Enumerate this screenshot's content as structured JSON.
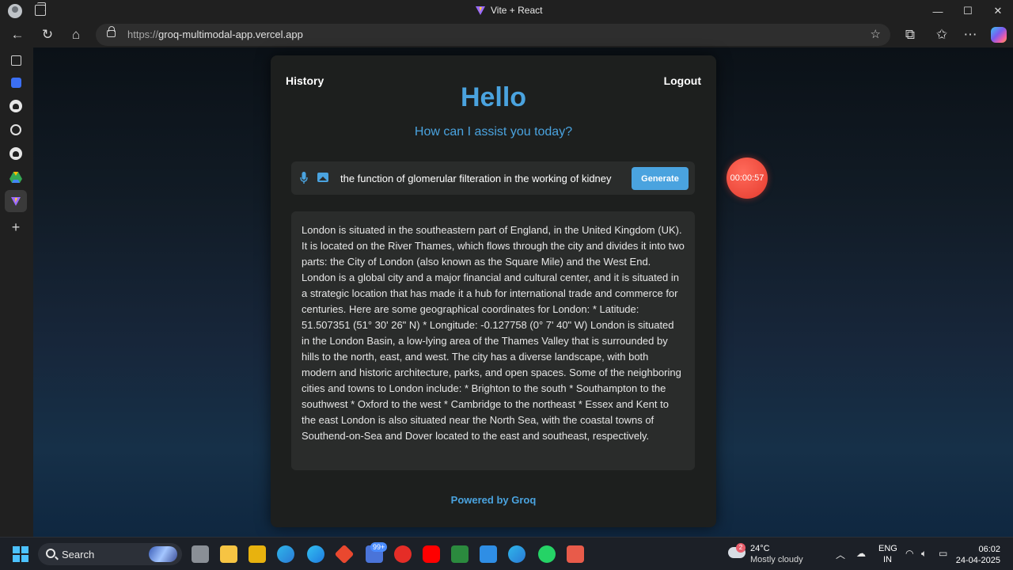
{
  "browser": {
    "tab_title": "Vite + React",
    "url_protocol": "https://",
    "url_host": "groq-multimodal-app.vercel.app",
    "controls": {
      "minimize": "—",
      "maximize": "☐",
      "close": "✕"
    }
  },
  "app": {
    "history_label": "History",
    "logout_label": "Logout",
    "heading": "Hello",
    "subheading": "How can I assist you today?",
    "prompt_value": "the function of glomerular filteration in the working of kidney",
    "generate_label": "Generate",
    "response_text": "London is situated in the southeastern part of England, in the United Kingdom (UK). It is located on the River Thames, which flows through the city and divides it into two parts: the City of London (also known as the Square Mile) and the West End. London is a global city and a major financial and cultural center, and it is situated in a strategic location that has made it a hub for international trade and commerce for centuries. Here are some geographical coordinates for London: * Latitude: 51.507351 (51° 30' 26\" N) * Longitude: -0.127758 (0° 7' 40\" W) London is situated in the London Basin, a low-lying area of the Thames Valley that is surrounded by hills to the north, east, and west. The city has a diverse landscape, with both modern and historic architecture, parks, and open spaces. Some of the neighboring cities and towns to London include: * Brighton to the south * Southampton to the southwest * Oxford to the west * Cambridge to the northeast * Essex and Kent to the east London is also situated near the North Sea, with the coastal towns of Southend-on-Sea and Dover located to the east and southeast, respectively.",
    "footer": "Powered by Groq",
    "timer": "00:00:57",
    "accent_color": "#4aa3df",
    "timer_color": "#e53b2e"
  },
  "taskbar": {
    "search_label": "Search",
    "store_badge": "99+",
    "weather_badge": "2",
    "temperature": "24°C",
    "condition": "Mostly cloudy",
    "lang_top": "ENG",
    "lang_bottom": "IN",
    "time": "06:02",
    "date": "24-04-2025"
  }
}
